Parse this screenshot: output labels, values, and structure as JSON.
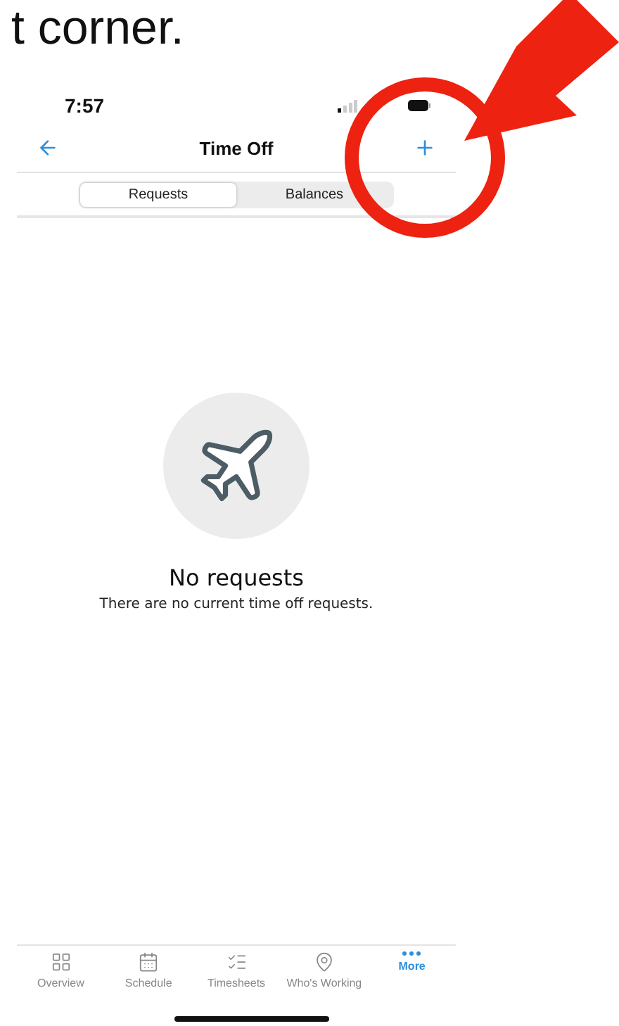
{
  "caption": "t corner.",
  "status_bar": {
    "time": "7:57"
  },
  "nav_bar": {
    "title": "Time Off"
  },
  "segments": [
    {
      "label": "Requests",
      "selected": true
    },
    {
      "label": "Balances",
      "selected": false
    }
  ],
  "empty_state": {
    "title": "No requests",
    "message": "There are no current time off requests."
  },
  "tab_bar": [
    {
      "label": "Overview",
      "selected": false
    },
    {
      "label": "Schedule",
      "selected": false
    },
    {
      "label": "Timesheets",
      "selected": false
    },
    {
      "label": "Who's Working",
      "selected": false
    },
    {
      "label": "More",
      "selected": true
    }
  ]
}
